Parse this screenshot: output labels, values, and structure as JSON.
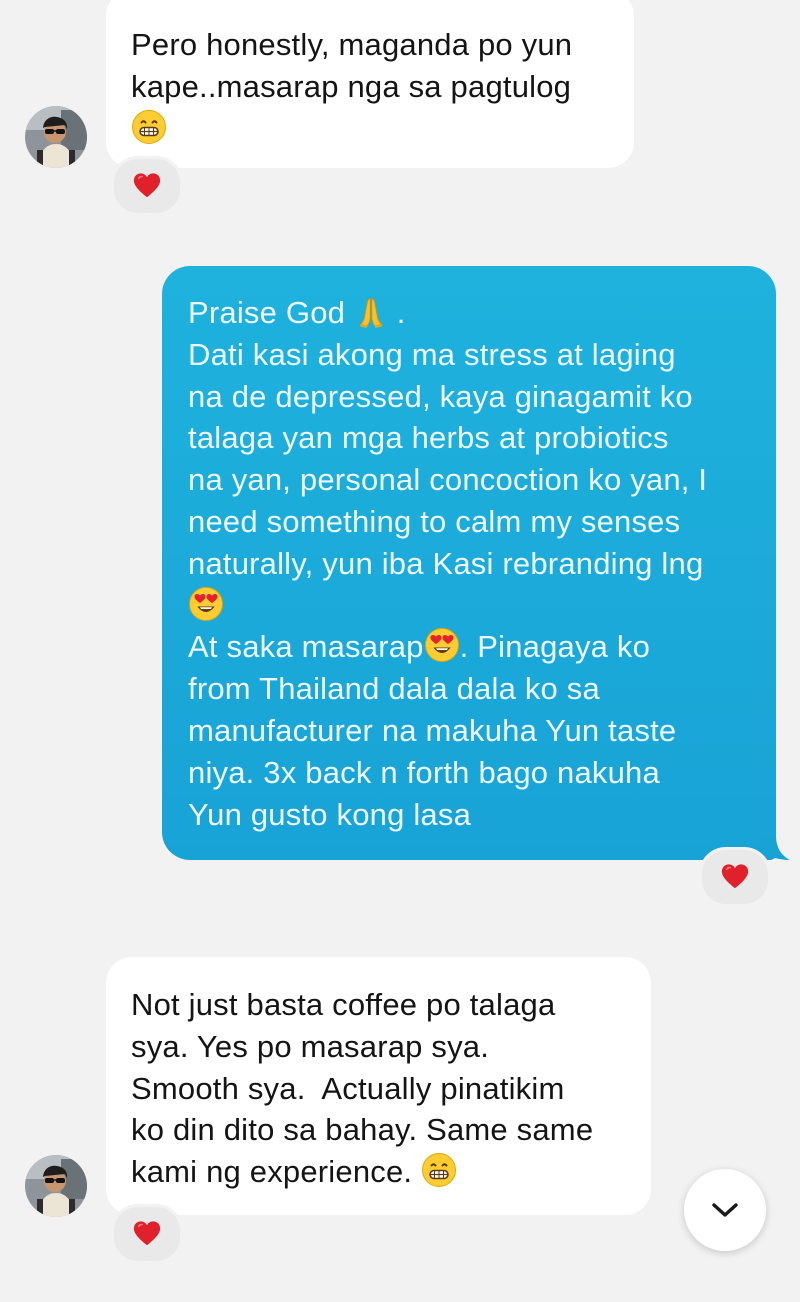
{
  "messages": [
    {
      "direction": "incoming",
      "lines": [
        "Pero honestly, maganda po yun",
        "kape..masarap nga sa pagtulog"
      ],
      "trailing_emoji": "grinning-face",
      "reaction": "heart"
    },
    {
      "direction": "outgoing",
      "lines": [
        "Praise God",
        "Dati kasi akong ma stress at laging",
        "na de depressed, kaya ginagamit ko",
        "talaga yan mga herbs at probiotics",
        "na yan, personal concoction ko yan, I",
        "need something to calm my senses",
        "naturally, yun iba Kasi rebranding lng",
        "At saka masarap",
        ". Pinagaya ko",
        "from Thailand dala dala ko sa",
        "manufacturer na makuha Yun taste",
        "niya. 3x back n forth bago nakuha",
        "Yun gusto kong lasa"
      ],
      "first_line_suffix": ".",
      "emojis": [
        "folded-hands",
        "heart-eyes-face",
        "heart-eyes-face"
      ],
      "reaction": "heart"
    },
    {
      "direction": "incoming",
      "lines": [
        "Not just basta coffee po talaga",
        "sya. Yes po masarap sya.",
        "Smooth sya.  Actually pinatikim",
        "ko din dito sa bahay. Same same",
        "kami ng experience."
      ],
      "trailing_emoji": "grinning-face",
      "reaction": "heart"
    }
  ],
  "colors": {
    "background": "#f2f2f2",
    "incoming_bubble": "#ffffff",
    "outgoing_bubble": "#1ca9d9",
    "heart": "#e0202a"
  },
  "controls": {
    "scroll_down_icon": "chevron-down-icon"
  }
}
